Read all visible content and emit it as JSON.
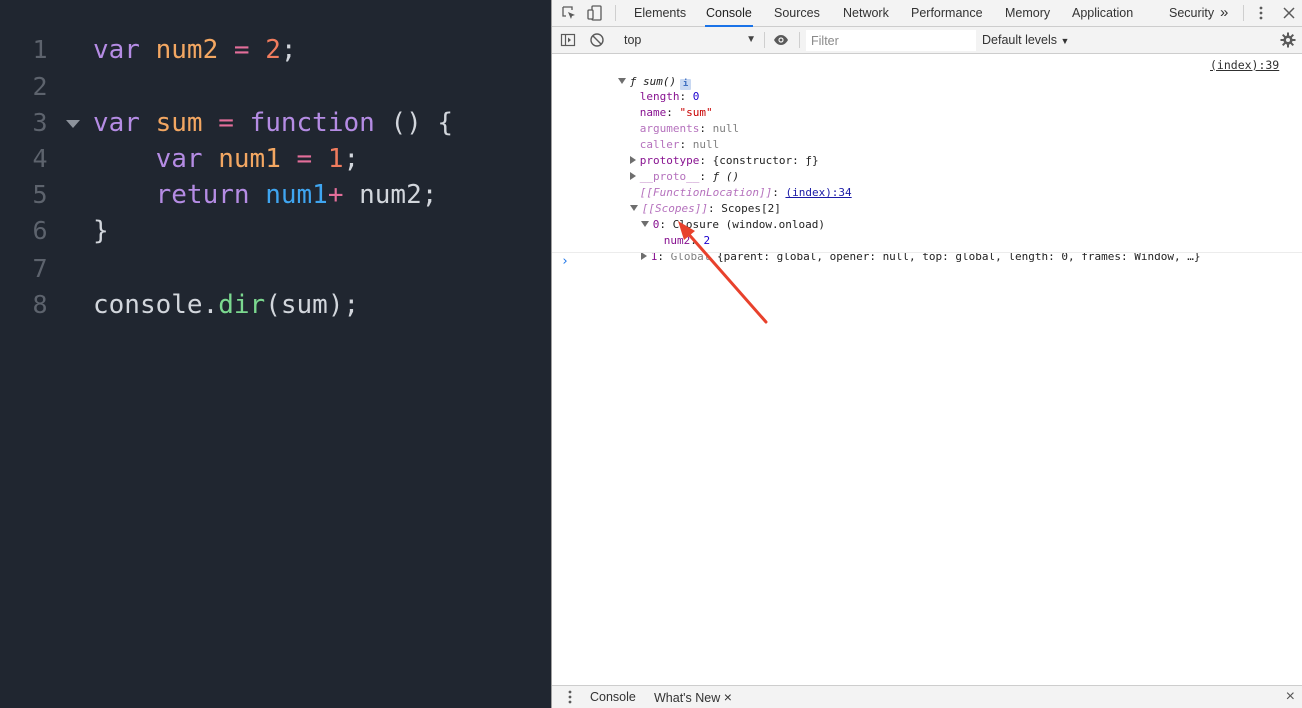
{
  "editor": {
    "lines": [
      {
        "n": "1",
        "tokens": [
          [
            "kw",
            "var "
          ],
          [
            "var",
            "num2"
          ],
          [
            "op",
            " = "
          ],
          [
            "num",
            "2"
          ],
          [
            "plain",
            ";"
          ]
        ]
      },
      {
        "n": "2",
        "tokens": []
      },
      {
        "n": "3",
        "tokens": [
          [
            "kw",
            "var "
          ],
          [
            "var",
            "sum"
          ],
          [
            "op",
            " = "
          ],
          [
            "fn",
            "function"
          ],
          [
            "plain",
            " () {"
          ]
        ],
        "fold": true
      },
      {
        "n": "4",
        "tokens": [
          [
            "kw",
            "    var "
          ],
          [
            "var",
            "num1"
          ],
          [
            "op",
            " = "
          ],
          [
            "num",
            "1"
          ],
          [
            "plain",
            ";"
          ]
        ]
      },
      {
        "n": "5",
        "tokens": [
          [
            "kw",
            "    return "
          ],
          [
            "blue",
            "num1"
          ],
          [
            "op",
            "+"
          ],
          [
            "plain",
            " num2;"
          ]
        ]
      },
      {
        "n": "6",
        "tokens": [
          [
            "plain",
            "}"
          ]
        ]
      },
      {
        "n": "7",
        "tokens": []
      },
      {
        "n": "8",
        "tokens": [
          [
            "plain",
            "console."
          ],
          [
            "green",
            "dir"
          ],
          [
            "plain",
            "(sum);"
          ]
        ]
      }
    ]
  },
  "devtools": {
    "tabs": [
      "Elements",
      "Console",
      "Sources",
      "Network",
      "Performance",
      "Memory",
      "Application",
      "Security"
    ],
    "active_tab": "Console",
    "more_tabs": "»",
    "context": "top",
    "filter_placeholder": "Filter",
    "levels": "Default levels",
    "source_link": "(index):39",
    "console": {
      "fn_label": "ƒ sum()",
      "info": "i",
      "length_key": "length",
      "length_val": "0",
      "name_key": "name",
      "name_val": "\"sum\"",
      "arguments_key": "arguments",
      "arguments_val": "null",
      "caller_key": "caller",
      "caller_val": "null",
      "prototype_key": "prototype",
      "prototype_val": "{constructor: ƒ}",
      "proto_key": "__proto__",
      "proto_val": "ƒ ()",
      "fnloc_key": "[[FunctionLocation]]",
      "fnloc_val": "(index):34",
      "scopes_key": "[[Scopes]]",
      "scopes_val": "Scopes[2]",
      "scope0_key": "0",
      "scope0_val": "Closure (window.onload)",
      "num2_key": "num2",
      "num2_val": "2",
      "scope1_key": "1",
      "scope1_type": "Global",
      "scope1_val": "{parent: global, opener: null, top: global, length: 0, frames: Window, …}"
    },
    "drawer": {
      "tabs": [
        "Console",
        "What's New"
      ],
      "close_tab": "×",
      "close": "×"
    }
  },
  "annotation_color": "#e8412c"
}
